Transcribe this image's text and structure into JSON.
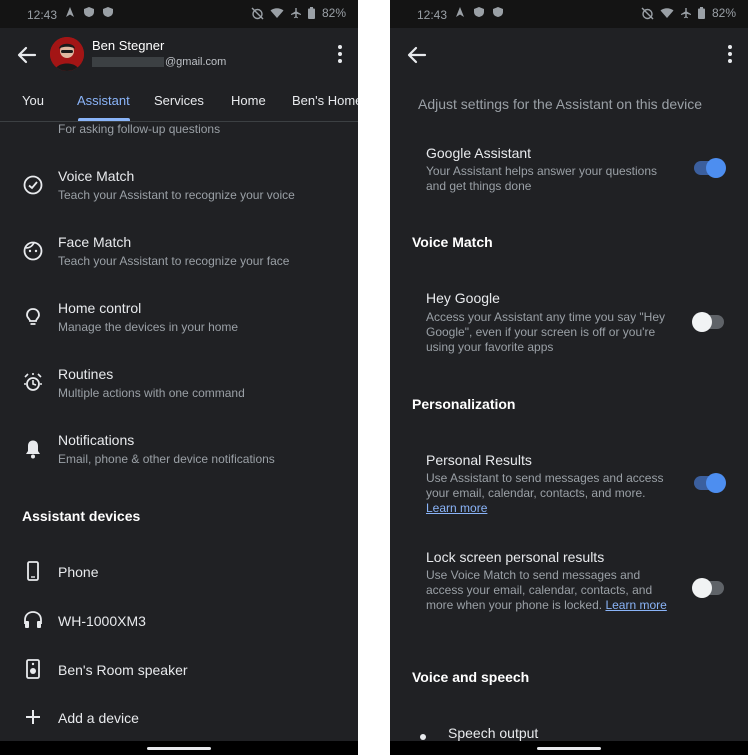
{
  "status": {
    "time": "12:43",
    "battery": "82%"
  },
  "left": {
    "account": {
      "name": "Ben Stegner",
      "email_suffix": "@gmail.com"
    },
    "tabs": [
      "You",
      "Assistant",
      "Services",
      "Home",
      "Ben's Home"
    ],
    "cut_subtitle": "For asking follow-up questions",
    "items": [
      {
        "title": "Voice Match",
        "subtitle": "Teach your Assistant to recognize your voice",
        "icon": "voice-match-icon"
      },
      {
        "title": "Face Match",
        "subtitle": "Teach your Assistant to recognize your face",
        "icon": "face-match-icon"
      },
      {
        "title": "Home control",
        "subtitle": "Manage the devices in your home",
        "icon": "lightbulb-icon"
      },
      {
        "title": "Routines",
        "subtitle": "Multiple actions with one command",
        "icon": "routines-icon"
      },
      {
        "title": "Notifications",
        "subtitle": "Email, phone & other device notifications",
        "icon": "bell-icon"
      }
    ],
    "devices_header": "Assistant devices",
    "devices": [
      {
        "label": "Phone",
        "icon": "phone-icon"
      },
      {
        "label": "WH-1000XM3",
        "icon": "headphones-icon"
      },
      {
        "label": "Ben's Room speaker",
        "icon": "speaker-icon"
      },
      {
        "label": "Add a device",
        "icon": "plus-icon"
      }
    ]
  },
  "right": {
    "intro": "Adjust settings for the Assistant on this device",
    "google_assistant": {
      "title": "Google Assistant",
      "desc": "Your Assistant helps answer your questions and get things done",
      "on": true
    },
    "voice_match_header": "Voice Match",
    "hey_google": {
      "title": "Hey Google",
      "desc": "Access your Assistant any time you say \"Hey Google\", even if your screen is off or you're using your favorite apps",
      "on": false
    },
    "personalization_header": "Personalization",
    "personal_results": {
      "title": "Personal Results",
      "desc": "Use Assistant to send messages and access your email, calendar, contacts, and more.",
      "link": "Learn more",
      "on": true
    },
    "lock_screen": {
      "title": "Lock screen personal results",
      "desc": "Use Voice Match to send messages and access your email, calendar, contacts, and more when your phone is locked.",
      "link": "Learn more",
      "on": false
    },
    "voice_speech_header": "Voice and speech",
    "speech_output": "Speech output"
  },
  "colors": {
    "background": "#202124",
    "accent": "#8ab4f8",
    "toggle_on": "#4d8ef0"
  }
}
